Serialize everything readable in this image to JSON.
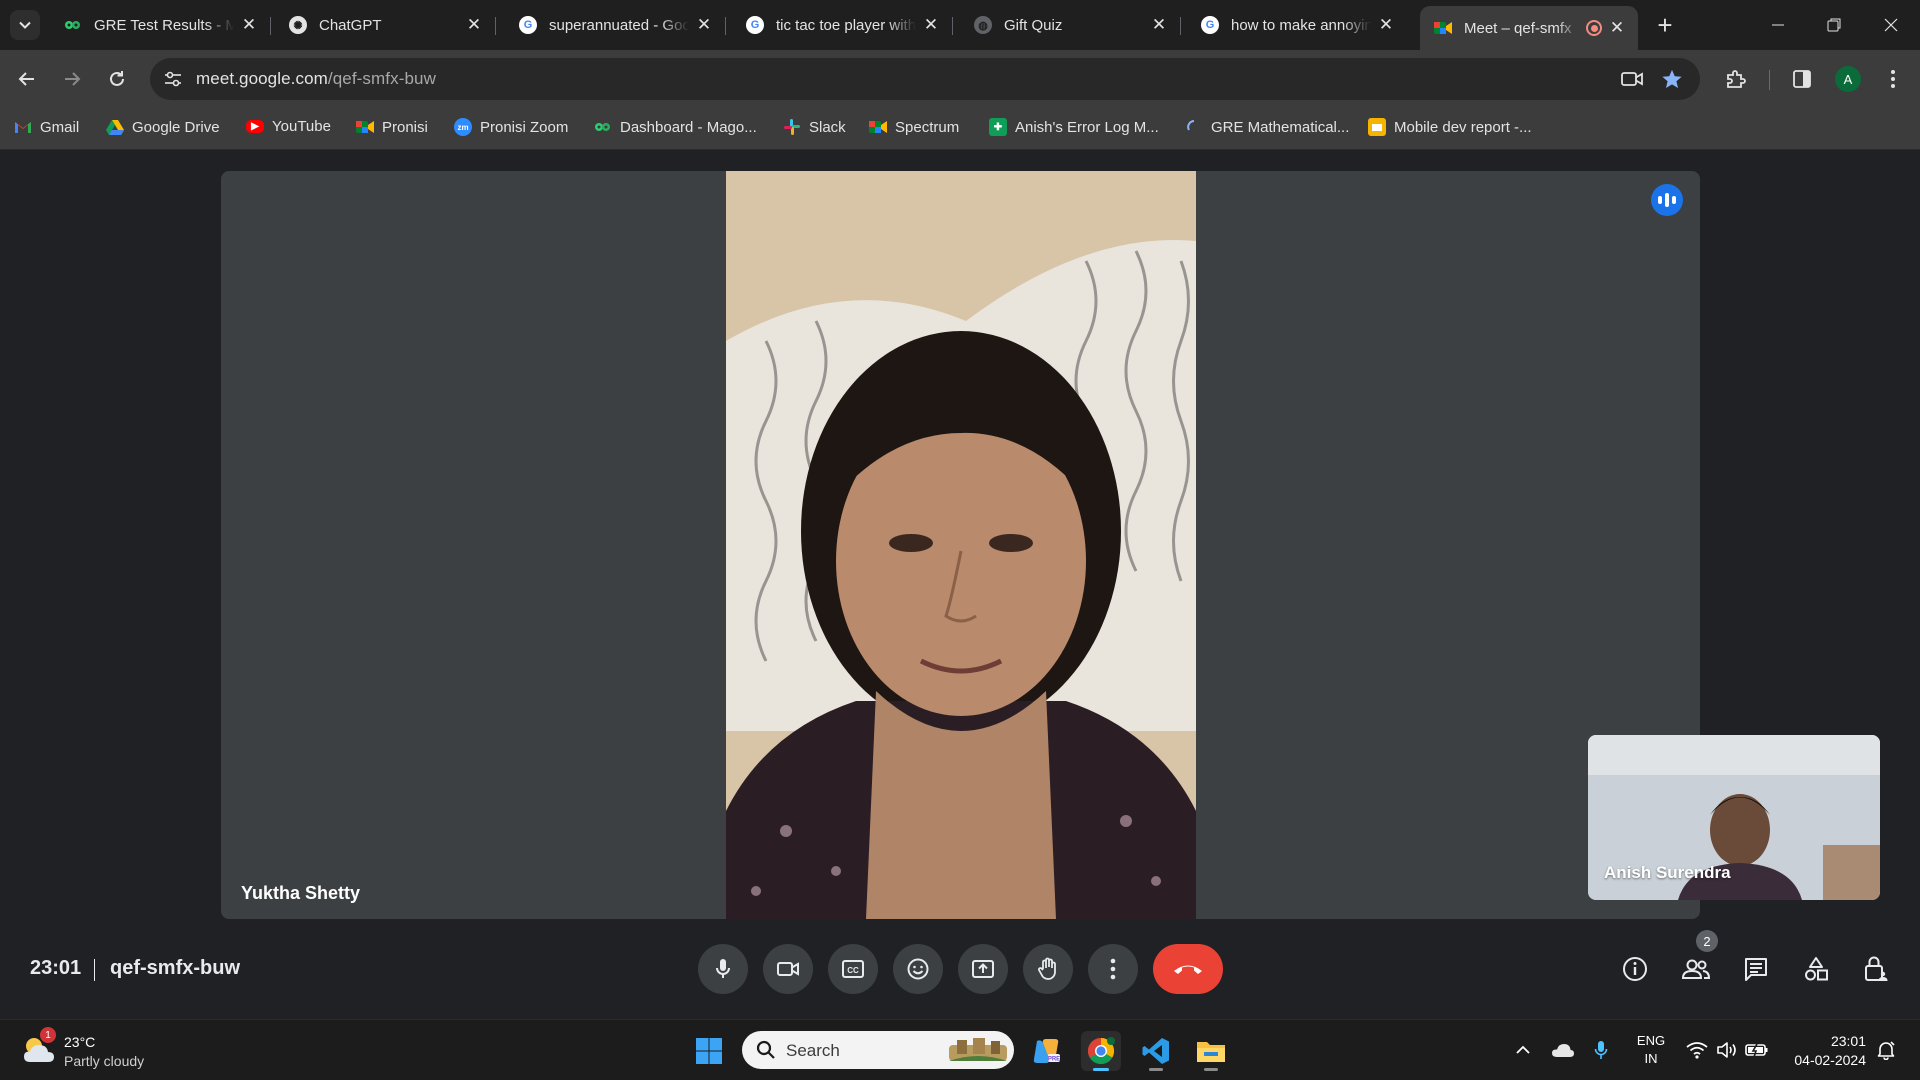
{
  "browser": {
    "tabs": [
      {
        "title": "GRE Test Results - Ma",
        "favicon": "magoosh-icon"
      },
      {
        "title": "ChatGPT",
        "favicon": "chatgpt-icon"
      },
      {
        "title": "superannuated - Goo",
        "favicon": "google-icon"
      },
      {
        "title": "tic tac toe player with",
        "favicon": "google-icon"
      },
      {
        "title": "Gift Quiz",
        "favicon": "globe-icon"
      },
      {
        "title": "how to make annoyin",
        "favicon": "google-icon"
      },
      {
        "title": "Meet – qef-smfx",
        "favicon": "meet-icon",
        "active": true,
        "recording": true
      }
    ],
    "url": {
      "host": "meet.google.com",
      "path": "/qef-smfx-buw"
    },
    "profile_initial": "A",
    "bookmarks": [
      {
        "label": "Gmail",
        "icon": "gmail-icon"
      },
      {
        "label": "Google Drive",
        "icon": "drive-icon"
      },
      {
        "label": "YouTube",
        "icon": "youtube-icon"
      },
      {
        "label": "Pronisi",
        "icon": "meet-icon"
      },
      {
        "label": "Pronisi Zoom",
        "icon": "zoom-icon"
      },
      {
        "label": "Dashboard - Mago...",
        "icon": "magoosh-icon"
      },
      {
        "label": "Slack",
        "icon": "slack-icon"
      },
      {
        "label": "Spectrum",
        "icon": "meet-icon"
      },
      {
        "label": "Anish's Error Log M...",
        "icon": "sheets-icon"
      },
      {
        "label": "GRE Mathematical...",
        "icon": "loading-icon"
      },
      {
        "label": "Mobile dev report -...",
        "icon": "slides-icon"
      }
    ]
  },
  "meet": {
    "main_participant": "Yuktha Shetty",
    "self_participant": "Anish Surendra",
    "time": "23:01",
    "meeting_code": "qef-smfx-buw",
    "participant_count": "2",
    "colors": {
      "accent": "#1a73e8",
      "end_call": "#ea4335",
      "tile": "#3c4043",
      "stage": "#202124"
    }
  },
  "taskbar": {
    "weather": {
      "temp": "23°C",
      "condition": "Partly cloudy",
      "badge": "1"
    },
    "search_label": "Search",
    "language": {
      "line1": "ENG",
      "line2": "IN"
    },
    "clock": {
      "time": "23:01",
      "date": "04-02-2024"
    }
  }
}
